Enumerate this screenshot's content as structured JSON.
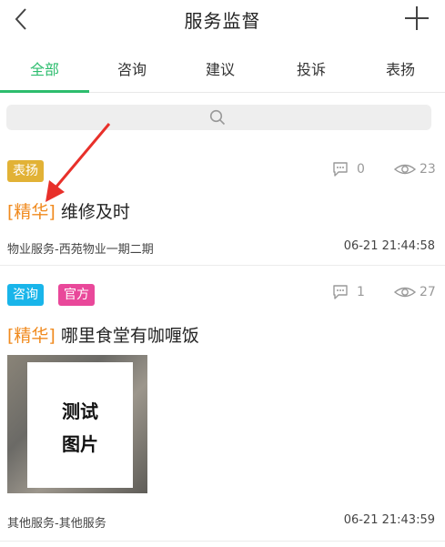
{
  "header": {
    "title": "服务监督"
  },
  "tabs": [
    {
      "label": "全部",
      "active": true
    },
    {
      "label": "咨询",
      "active": false
    },
    {
      "label": "建议",
      "active": false
    },
    {
      "label": "投诉",
      "active": false
    },
    {
      "label": "表扬",
      "active": false
    }
  ],
  "colors": {
    "accent": "#2dbd6e",
    "tag_highlight": "#f08a1e",
    "badge_praise": "#e2b236",
    "badge_consult": "#19b5ea",
    "badge_official": "#e9489a",
    "annotation_arrow": "#e8302a"
  },
  "icons": {
    "back": "chevron-left-icon",
    "add": "plus-icon",
    "search": "search-icon",
    "comments": "comment-bubble-icon",
    "views": "eye-icon"
  },
  "posts": [
    {
      "badges": [
        "表扬"
      ],
      "comments": "0",
      "views": "23",
      "tag": "[精华]",
      "title": "维修及时",
      "category": "物业服务-西苑物业一期二期",
      "time": "06-21 21:44:58"
    },
    {
      "badges": [
        "咨询",
        "官方"
      ],
      "comments": "1",
      "views": "27",
      "tag": "[精华]",
      "title": "哪里食堂有咖喱饭",
      "image_text": [
        "测试",
        "图片"
      ],
      "category": "其他服务-其他服务",
      "time": "06-21 21:43:59"
    }
  ]
}
